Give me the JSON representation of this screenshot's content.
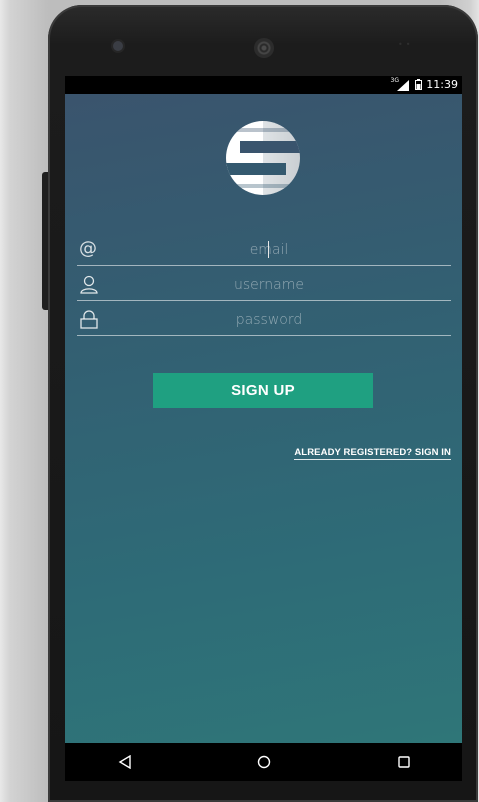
{
  "status_bar": {
    "time": "11:39",
    "network": "3G"
  },
  "form": {
    "email": {
      "value": "",
      "placeholder": "email"
    },
    "username": {
      "value": "",
      "placeholder": "username"
    },
    "password": {
      "value": "",
      "placeholder": "password"
    }
  },
  "signup_button": {
    "label": "SIGN UP"
  },
  "signin_link": {
    "label": "ALREADY REGISTERED? SIGN IN"
  },
  "icons": {
    "email": "at-sign-icon",
    "username": "user-icon",
    "password": "lock-icon",
    "back": "back-triangle-icon",
    "home": "home-circle-icon",
    "recents": "recents-square-icon"
  },
  "colors": {
    "accent": "#1fa081",
    "gradient_top": "#3a546d",
    "gradient_bottom": "#2f7678",
    "phone_frame": "#1c1c1c"
  }
}
